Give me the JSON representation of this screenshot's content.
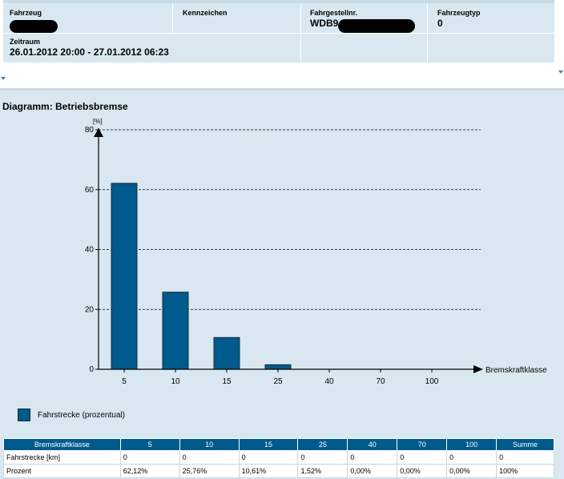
{
  "header": {
    "fahrzeug_label": "Fahrzeug",
    "kennzeichen_label": "Kennzeichen",
    "fahrgestellnr_label": "Fahrgestellnr.",
    "fahrgestellnr_value": "WDB9",
    "fahrzeugtyp_label": "Fahrzeugtyp",
    "fahrzeugtyp_value": "0",
    "zeitraum_label": "Zeitraum",
    "zeitraum_value": "26.01.2012 20:00 - 27.01.2012 06:23"
  },
  "diagram": {
    "title": "Diagramm: Betriebsbremse",
    "legend": "Fahrstrecke (prozentual)"
  },
  "chart_data": {
    "type": "bar",
    "categories": [
      "5",
      "10",
      "15",
      "25",
      "40",
      "70",
      "100"
    ],
    "values": [
      62.12,
      25.76,
      10.61,
      1.52,
      0,
      0,
      0
    ],
    "xlabel": "Bremskraftklasse",
    "ylabel": "[%]",
    "ylim": [
      0,
      80
    ],
    "yticks": [
      0,
      20,
      40,
      60,
      80
    ],
    "grid": true,
    "legend_position": "bottom-left",
    "bar_color": "#005a8c"
  },
  "table": {
    "headers": [
      "Bremskraftklasse",
      "5",
      "10",
      "15",
      "25",
      "40",
      "70",
      "100",
      "Summe"
    ],
    "rows": [
      [
        "Fahrstrecke [km]",
        "0",
        "0",
        "0",
        "0",
        "0",
        "0",
        "0",
        "0"
      ],
      [
        "Prozent",
        "62,12%",
        "25,76%",
        "10,61%",
        "1,52%",
        "0,00%",
        "0,00%",
        "0,00%",
        "100%"
      ]
    ]
  }
}
